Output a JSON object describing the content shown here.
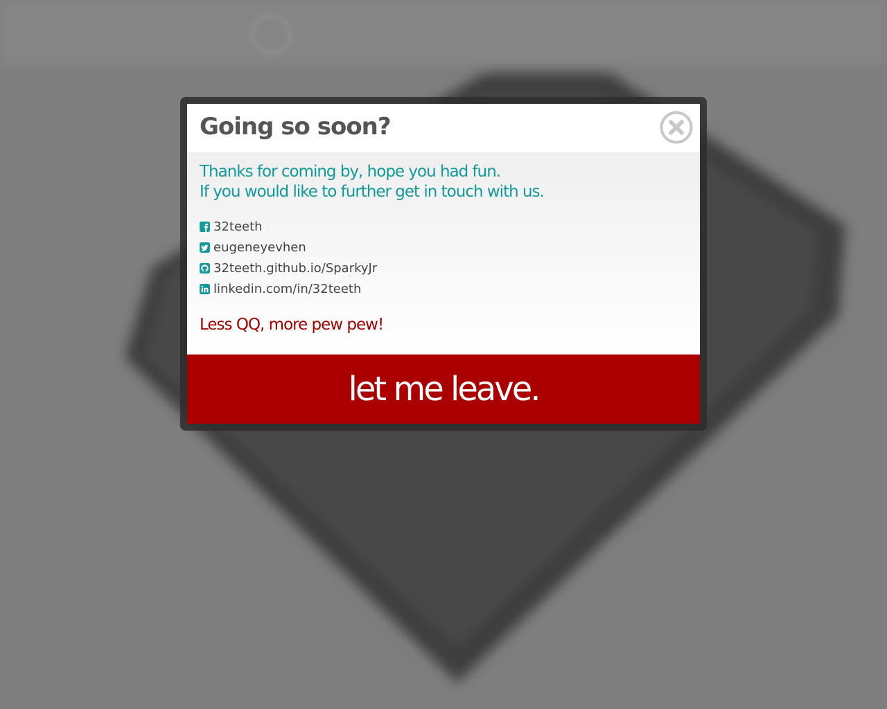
{
  "modal": {
    "title": "Going so soon?",
    "intro_line_1": "Thanks for coming by, hope you had fun.",
    "intro_line_2": "If you would like to further get in touch with us.",
    "links": [
      {
        "icon": "facebook-icon",
        "label": "32teeth"
      },
      {
        "icon": "twitter-icon",
        "label": "eugeneyevhen"
      },
      {
        "icon": "github-icon",
        "label": "32teeth.github.io/SparkyJr"
      },
      {
        "icon": "linkedin-icon",
        "label": "linkedin.com/in/32teeth"
      }
    ],
    "tagline": "Less QQ, more pew pew!",
    "leave_label": "let me leave.",
    "close_icon": "close-icon"
  },
  "colors": {
    "accent_teal": "#13999a",
    "tagline_red": "#9f0000",
    "button_red": "#ab0000",
    "title_gray": "#555555",
    "overlay_gray": "#7e7e7e"
  }
}
